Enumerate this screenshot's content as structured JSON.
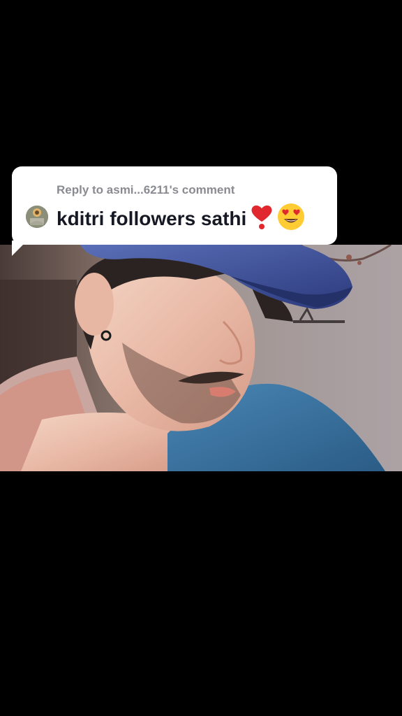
{
  "reply": {
    "header": "Reply to asmi...6211's comment",
    "comment_text": "kditri followers sathi",
    "emojis": [
      "heart-exclamation-icon",
      "heart-eyes-face-icon"
    ]
  },
  "colors": {
    "background": "#000000",
    "bubble": "#ffffff",
    "header_text": "#8a8b91",
    "comment_text": "#161823",
    "cap": "#3b4d9a",
    "shirt": "#3c6e9a"
  }
}
